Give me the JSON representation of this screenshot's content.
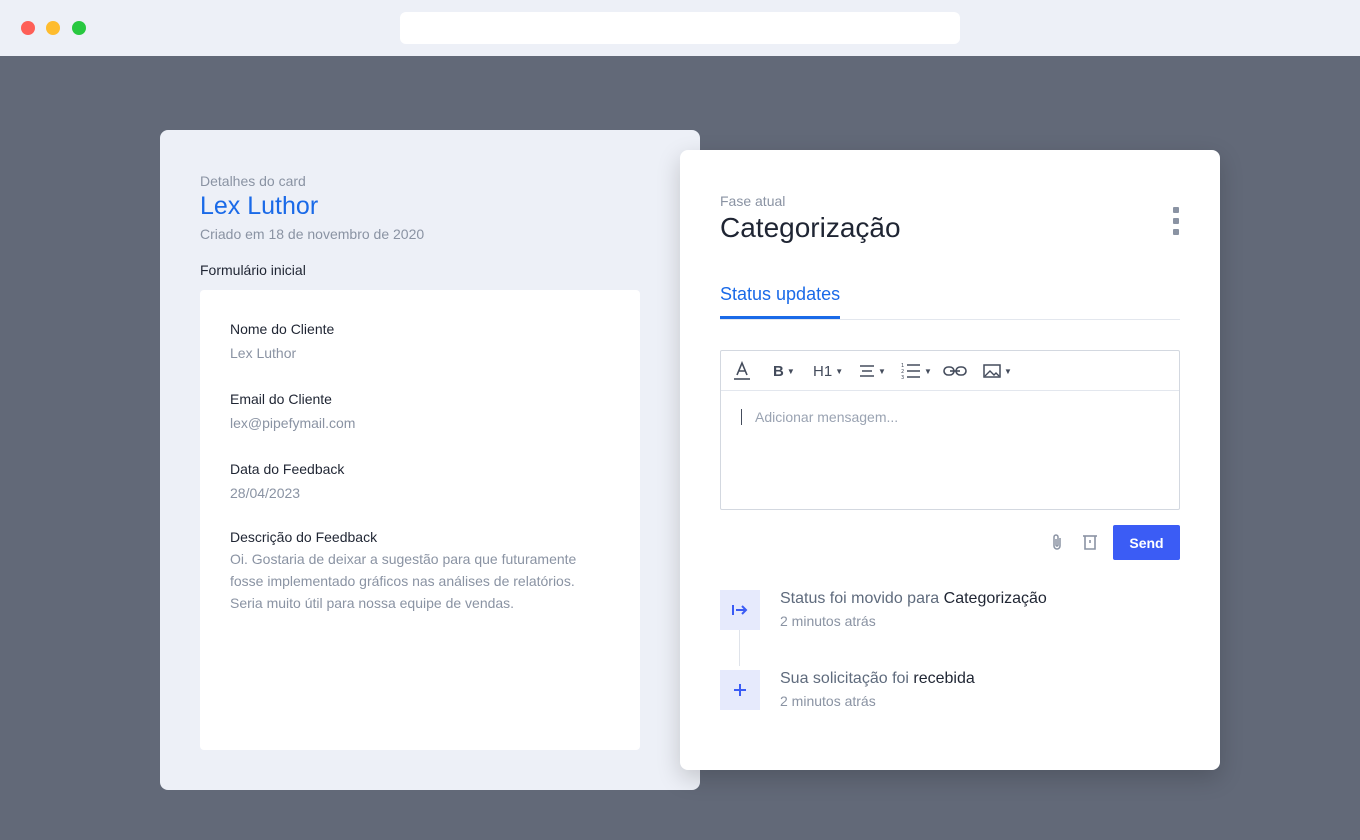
{
  "left": {
    "kicker": "Detalhes do card",
    "name": "Lex Luthor",
    "created": "Criado em 18 de novembro de 2020",
    "form_title": "Formulário inicial",
    "fields": [
      {
        "label": "Nome do Cliente",
        "value": "Lex Luthor"
      },
      {
        "label": "Email do Cliente",
        "value": "lex@pipefymail.com"
      },
      {
        "label": "Data do Feedback",
        "value": "28/04/2023"
      },
      {
        "label": "Descrição do Feedback",
        "value_lines": [
          "Oi. Gostaria de deixar a sugestão para que futuramente",
          "fosse implementado gráficos nas análises de relatórios.",
          "Seria muito útil para nossa equipe de vendas."
        ]
      }
    ]
  },
  "right": {
    "kicker": "Fase atual",
    "title": "Categorização",
    "tab": "Status updates",
    "toolbar": {
      "bold": "B",
      "heading": "H1",
      "icons": [
        "text-color-icon",
        "bold-icon",
        "heading-icon",
        "align-icon",
        "numbered-list-icon",
        "link-icon",
        "image-icon"
      ]
    },
    "editor_placeholder": "Adicionar mensagem...",
    "send_label": "Send",
    "timeline": [
      {
        "prefix": "Status foi movido para ",
        "highlight": "Categorização",
        "time": "2 minutos atrás",
        "icon": "move-arrow-icon"
      },
      {
        "prefix": "Sua solicitação foi ",
        "highlight": "recebida",
        "time": "2 minutos atrás",
        "icon": "plus-icon"
      }
    ]
  },
  "colors": {
    "accent": "#1a6ae8",
    "send_button": "#3b5cf5",
    "backdrop": "#626978",
    "panel_bg": "#edf0f7"
  }
}
